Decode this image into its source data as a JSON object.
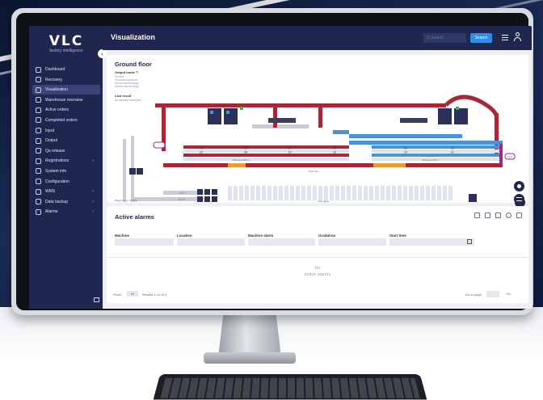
{
  "app": {
    "logo": "VLC",
    "logo_sub": "factory intelligence",
    "page_title": "Visualization"
  },
  "topbar": {
    "search_placeholder": "Q Search...",
    "search_button": "Search"
  },
  "sidebar": {
    "items": [
      {
        "label": "Dashboard",
        "icon": "grid-icon",
        "active": false,
        "chevron": false
      },
      {
        "label": "Recovery",
        "icon": "refresh-icon",
        "active": false,
        "chevron": false
      },
      {
        "label": "Visualization",
        "icon": "eye-icon",
        "active": true,
        "chevron": false
      },
      {
        "label": "Warehouse overview",
        "icon": "warehouse-icon",
        "active": false,
        "chevron": false
      },
      {
        "label": "Active orders",
        "icon": "clock-icon",
        "active": false,
        "chevron": false
      },
      {
        "label": "Completed orders",
        "icon": "check-icon",
        "active": false,
        "chevron": false
      },
      {
        "label": "Input",
        "icon": "input-icon",
        "active": false,
        "chevron": false
      },
      {
        "label": "Output",
        "icon": "output-icon",
        "active": false,
        "chevron": false
      },
      {
        "label": "Qa release",
        "icon": "qa-icon",
        "active": false,
        "chevron": false
      },
      {
        "label": "Registrations",
        "icon": "list-icon",
        "active": false,
        "chevron": true
      },
      {
        "label": "System info",
        "icon": "info-icon",
        "active": false,
        "chevron": false
      },
      {
        "label": "Configuration",
        "icon": "config-icon",
        "active": false,
        "chevron": false
      },
      {
        "label": "WMS",
        "icon": "wms-icon",
        "active": false,
        "chevron": true
      },
      {
        "label": "Data backup",
        "icon": "backup-icon",
        "active": false,
        "chevron": true
      },
      {
        "label": "Alarms",
        "icon": "alarm-icon",
        "active": false,
        "chevron": true
      }
    ]
  },
  "floor": {
    "title": "Ground floor",
    "output_mode_label": "Output mode",
    "output_lines": [
      "Product",
      "Provisional products",
      "Source where supply",
      "Source where supply"
    ],
    "last_result_label": "Last result",
    "last_result_text": "No capacity description",
    "grid_values": [
      [
        "36",
        "35",
        "34",
        "51"
      ],
      [
        "29",
        "58",
        "57",
        "18"
      ],
      [
        "22",
        "21"
      ],
      [
        "24",
        "21"
      ]
    ],
    "labels": {
      "storage_buffer_2": "Storage buffer 2",
      "storage_buffer_1": "Storage buffer 1",
      "entry_line": "Entry line",
      "exit_gates": "Exit gates",
      "line_a": "Line",
      "line_b": "Line B",
      "out": "OUT",
      "weight_info": "Weight in (s): 37.5kg"
    }
  },
  "alarms": {
    "title": "Active alarms",
    "columns": [
      "Machine",
      "Location",
      "Machine alarm",
      "Gradation",
      "Start time"
    ],
    "empty_line1": "No",
    "empty_line2": "active alarms",
    "show_label": "Show",
    "show_value": "10",
    "results_text": "Results 1-10 of 0",
    "goto_label": "Go to page",
    "go_label": "Go"
  },
  "colors": {
    "sidebar": "#1f2751",
    "accent": "#2e8de6",
    "conveyor_red": "#a42a38",
    "conveyor_blue": "#4b93d8",
    "magenta": "#9b2a8a"
  }
}
